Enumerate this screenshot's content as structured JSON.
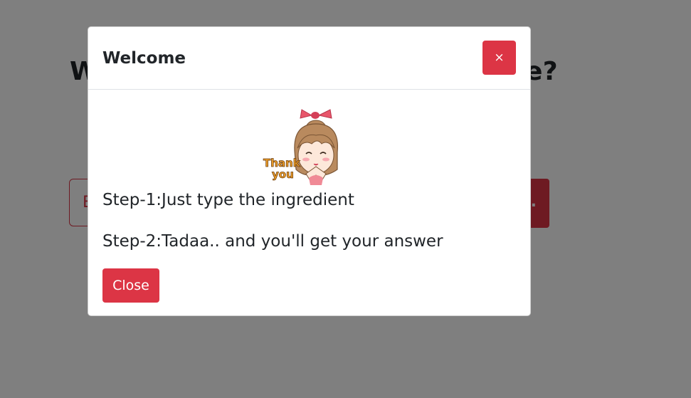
{
  "background": {
    "heading_start": "W",
    "heading_end": "e?",
    "input_visible_char": "E",
    "button_visible_char": "."
  },
  "modal": {
    "title": "Welcome",
    "close_x_label": "×",
    "sticker": {
      "text_line1": "Thank",
      "text_line2": "you"
    },
    "steps": [
      "Step-1:Just type the ingredient",
      "Step-2:Tadaa.. and you'll get your answer"
    ],
    "close_button_label": "Close"
  },
  "colors": {
    "accent": "#dc3545",
    "backdrop": "rgba(0,0,0,0.5)",
    "text": "#212529"
  }
}
